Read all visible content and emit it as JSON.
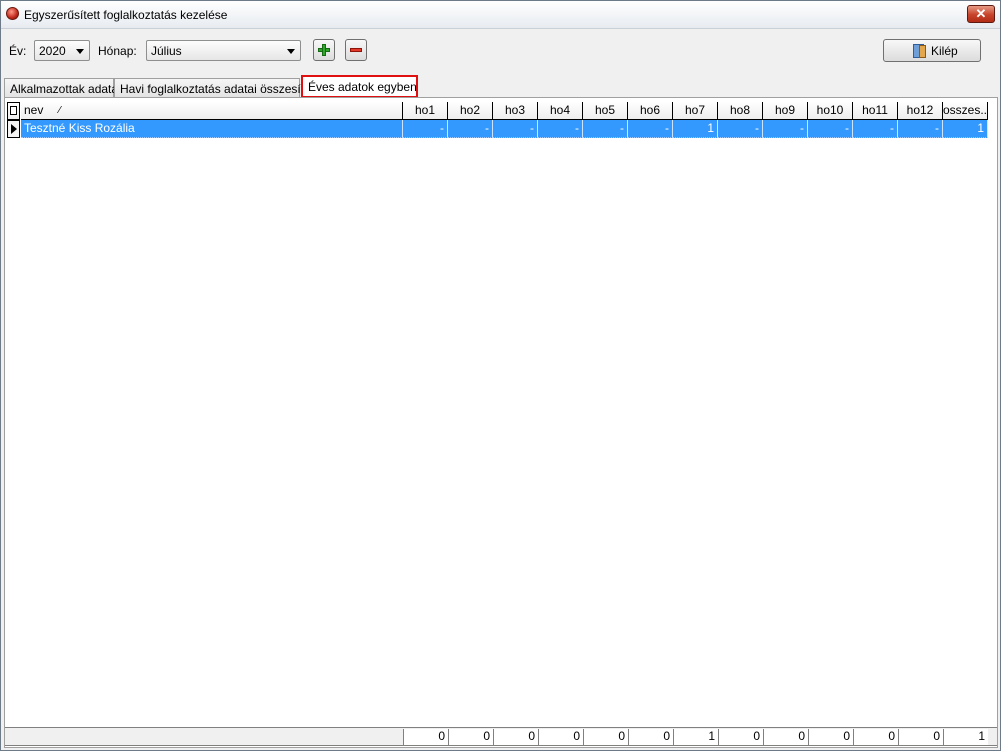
{
  "window": {
    "title": "Egyszerűsített foglalkoztatás kezelése",
    "close_label": "✕"
  },
  "toolbar": {
    "year_label": "Év:",
    "year_value": "2020",
    "month_label": "Hónap:",
    "month_value": "Július",
    "exit_label": "Kilép"
  },
  "tabs": [
    {
      "label": "Alkalmazottak adatai",
      "active": false
    },
    {
      "label": "Havi foglalkoztatás adatai összesítve",
      "active": false
    },
    {
      "label": "Éves adatok egyben",
      "active": true
    }
  ],
  "grid": {
    "columns": [
      "nev",
      "ho1",
      "ho2",
      "ho3",
      "ho4",
      "ho5",
      "ho6",
      "ho7",
      "ho8",
      "ho9",
      "ho10",
      "ho11",
      "ho12",
      "osszes..."
    ],
    "sort_indicator": "⁄",
    "rows": [
      {
        "nev": "Tesztné Kiss Rozália",
        "values": [
          "-",
          "-",
          "-",
          "-",
          "-",
          "-",
          "1",
          "-",
          "-",
          "-",
          "-",
          "-",
          "1"
        ]
      }
    ],
    "totals": [
      "0",
      "0",
      "0",
      "0",
      "0",
      "0",
      "1",
      "0",
      "0",
      "0",
      "0",
      "0",
      "1"
    ]
  },
  "colors": {
    "selection": "#3399ff",
    "highlight_border": "#e01010"
  }
}
